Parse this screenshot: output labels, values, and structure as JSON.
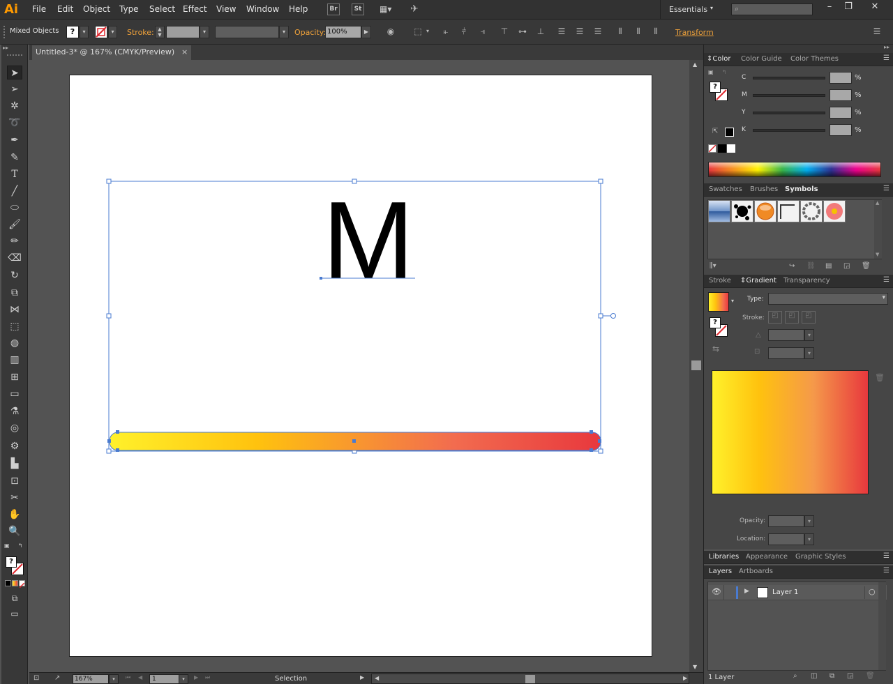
{
  "app": {
    "logo": "Ai"
  },
  "menubar": {
    "items": [
      "File",
      "Edit",
      "Object",
      "Type",
      "Select",
      "Effect",
      "View",
      "Window",
      "Help"
    ],
    "bridge": "Br",
    "stock": "St",
    "workspace": "Essentials"
  },
  "control_bar": {
    "selection_label": "Mixed Objects",
    "stroke_label": "Stroke:",
    "opacity_label": "Opacity:",
    "opacity_value": "100%",
    "transform_label": "Transform"
  },
  "document": {
    "tab_title": "Untitled-3* @ 167% (CMYK/Preview)",
    "close": "×",
    "text_on_artboard": "M",
    "gradient_colors": [
      "#fff12b",
      "#ffc20e",
      "#f26c4f",
      "#e8383d"
    ]
  },
  "statusbar": {
    "zoom": "167%",
    "artboard_num": "1",
    "tool": "Selection"
  },
  "color_panel": {
    "tabs": [
      "Color",
      "Color Guide",
      "Color Themes"
    ],
    "channels": [
      "C",
      "M",
      "Y",
      "K"
    ],
    "pct": "%"
  },
  "symbols_panel": {
    "tabs": [
      "Swatches",
      "Brushes",
      "Symbols"
    ]
  },
  "gradient_panel": {
    "tabs": [
      "Stroke",
      "Gradient",
      "Transparency"
    ],
    "type_label": "Type:",
    "stroke_label": "Stroke:",
    "opacity_label": "Opacity:",
    "location_label": "Location:"
  },
  "libraries_panel": {
    "tabs": [
      "Libraries",
      "Appearance",
      "Graphic Styles"
    ]
  },
  "layers_panel": {
    "tabs": [
      "Layers",
      "Artboards"
    ],
    "layers": [
      {
        "name": "Layer 1"
      }
    ],
    "count": "1 Layer"
  }
}
